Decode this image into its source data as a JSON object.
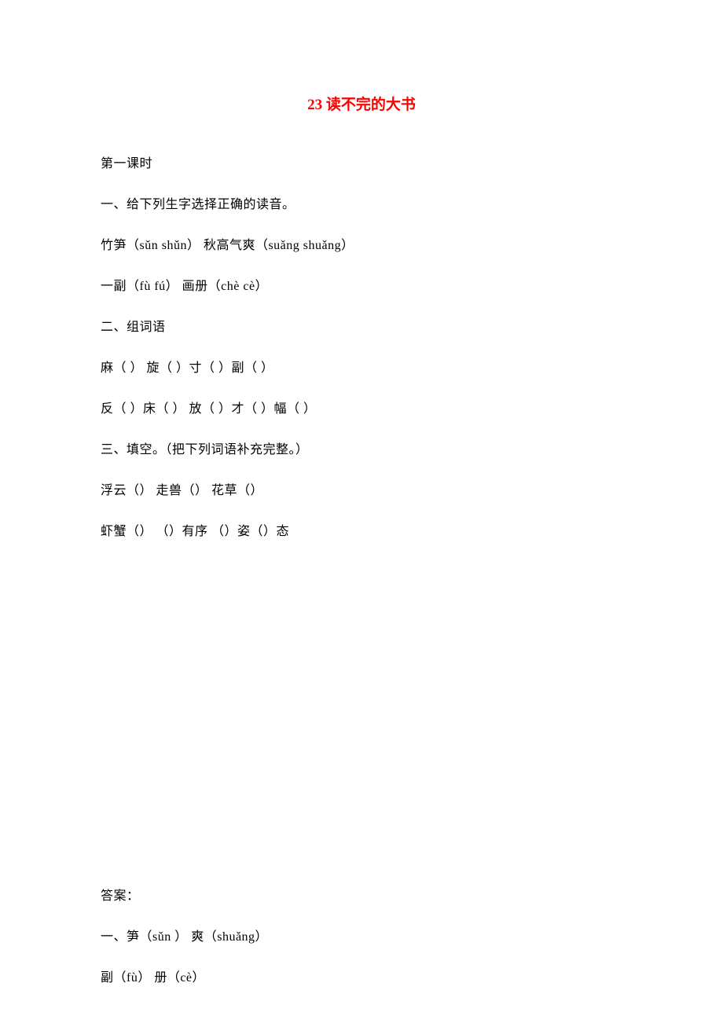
{
  "title": "23 读不完的大书",
  "subtitle": "第一课时",
  "section1": {
    "heading": "一、给下列生字选择正确的读音。",
    "line1": "竹笋（sǔn    shǔn）    秋高气爽（suǎng    shuǎng）",
    "line2": "一副（fù     fú）       画册（chè     cè）"
  },
  "section2": {
    "heading": "二、组词语",
    "line1": "麻（    ）   旋（   ）寸（     ）副（    ）",
    "line2": "反（    ）床（    ）  放（    ）才（    ）幅（    ）"
  },
  "section3": {
    "heading": "三、填空。（把下列词语补充完整。）",
    "line1": "浮云（）   走兽（）     花草（）",
    "line2": "虾蟹（）  （）有序     （）姿（）态"
  },
  "answers": {
    "heading": "答案：",
    "line1": "一、笋（sǔn ）    爽（shuǎng）",
    "line2": "副（fù）      册（cè）"
  }
}
